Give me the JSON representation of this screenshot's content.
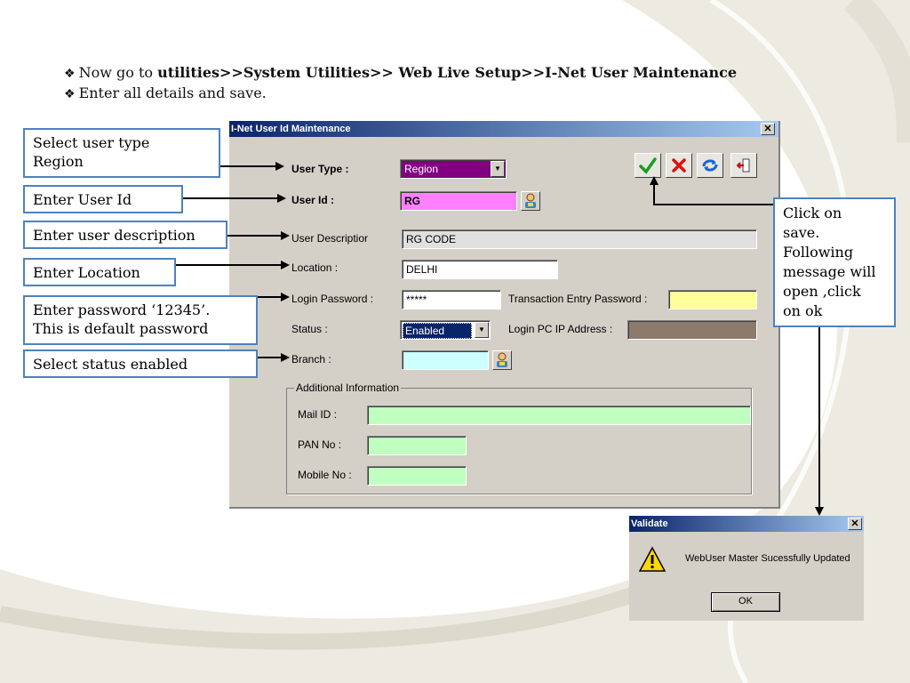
{
  "instructions": {
    "bullet_icon": "❖",
    "line1_prefix": "Now  go to ",
    "line1_path": "utilities>>System Utilities>> Web Live Setup>>I-Net User Maintenance",
    "line2": "Enter all details and save."
  },
  "callouts": {
    "user_type_line1": "Select user type",
    "user_type_line2": "Region",
    "user_id": "Enter  User Id",
    "user_desc": "Enter user description",
    "location": "Enter Location",
    "password_line1": "Enter password ‘12345’.",
    "password_line2": "This is default password",
    "status": "Select status enabled",
    "save_line1": "Click on",
    "save_line2": "save.",
    "save_line3": "Following",
    "save_line4": "message will",
    "save_line5": "open ,click",
    "save_line6": "on ok"
  },
  "dialog": {
    "title": "I-Net User Id Maintenance",
    "close_glyph": "✕",
    "fields": {
      "user_type_label": "User Type :",
      "user_type_value": "Region",
      "user_id_label": "User Id :",
      "user_id_value": "RG",
      "user_desc_label": "User Descriptior",
      "user_desc_value": "RG CODE",
      "location_label": "Location :",
      "location_value": "DELHI",
      "login_password_label": "Login Password :",
      "login_password_value": "*****",
      "transaction_password_label": "Transaction Entry Password :",
      "transaction_password_value": "",
      "status_label": "Status :",
      "status_value": "Enabled",
      "login_ip_label": "Login PC IP Address :",
      "login_ip_value": "",
      "branch_label": "Branch :",
      "branch_value": ""
    },
    "additional": {
      "legend": "Additional Information",
      "mail_label": "Mail ID :",
      "mail_value": "",
      "pan_label": "PAN No :",
      "pan_value": "",
      "mobile_label": "Mobile No :",
      "mobile_value": ""
    },
    "toolbar_icons": [
      "save-check-icon",
      "cancel-x-icon",
      "refresh-icon",
      "exit-door-icon"
    ],
    "colors": {
      "user_type_bg": "#800080",
      "user_id_bg": "#ff80ff",
      "desc_bg": "#e0e0e0",
      "trans_pw_bg": "#ffff99",
      "status_bg": "#0a246a",
      "ip_bg": "#8c7b6d",
      "branch_bg": "#ccffff",
      "additional_bg": "#c0ffc0"
    }
  },
  "validate": {
    "title": "Validate",
    "close_glyph": "✕",
    "message": "WebUser Master Sucessfully Updated",
    "ok_label": "OK",
    "icon": "warning-icon"
  }
}
